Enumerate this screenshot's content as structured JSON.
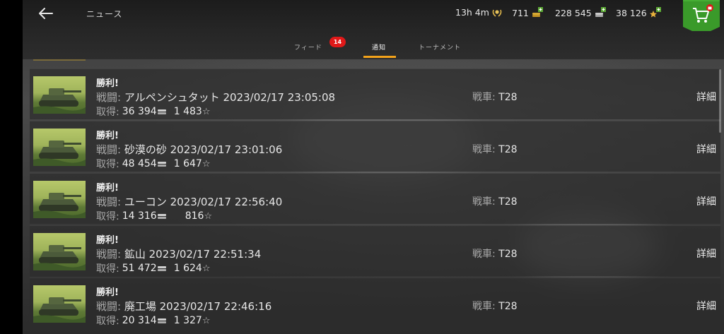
{
  "header": {
    "title": "ニュース",
    "timer": "13h 4m",
    "gold": "711",
    "credits": "228 545",
    "free_xp": "38 126"
  },
  "tabs": [
    {
      "label": "フィード",
      "badge": "14",
      "active": false
    },
    {
      "label": "通知",
      "active": true
    },
    {
      "label": "トーナメント",
      "active": false
    }
  ],
  "labels": {
    "battle": "戦闘:",
    "reward": "取得:",
    "tank": "戦車:",
    "details": "詳細"
  },
  "notifications": [
    {
      "result": "勝利!",
      "map": "アルペンシュタット",
      "datetime": "2023/02/17 23:05:08",
      "credits": "36 394",
      "xp": "1 483",
      "tank": "T28"
    },
    {
      "result": "勝利!",
      "map": "砂漠の砂",
      "datetime": "2023/02/17 23:01:06",
      "credits": "48 454",
      "xp": "1 647",
      "tank": "T28"
    },
    {
      "result": "勝利!",
      "map": "ユーコン",
      "datetime": "2023/02/17 22:56:40",
      "credits": "14 316",
      "xp": "816",
      "tank": "T28"
    },
    {
      "result": "勝利!",
      "map": "鉱山",
      "datetime": "2023/02/17 22:51:34",
      "credits": "51 472",
      "xp": "1 624",
      "tank": "T28"
    },
    {
      "result": "勝利!",
      "map": "廃工場",
      "datetime": "2023/02/17 22:46:16",
      "credits": "20 314",
      "xp": "1 327",
      "tank": "T28"
    }
  ],
  "colors": {
    "accent": "#f2a21a",
    "badge": "#e01919",
    "shop": "#3a9a2a"
  }
}
